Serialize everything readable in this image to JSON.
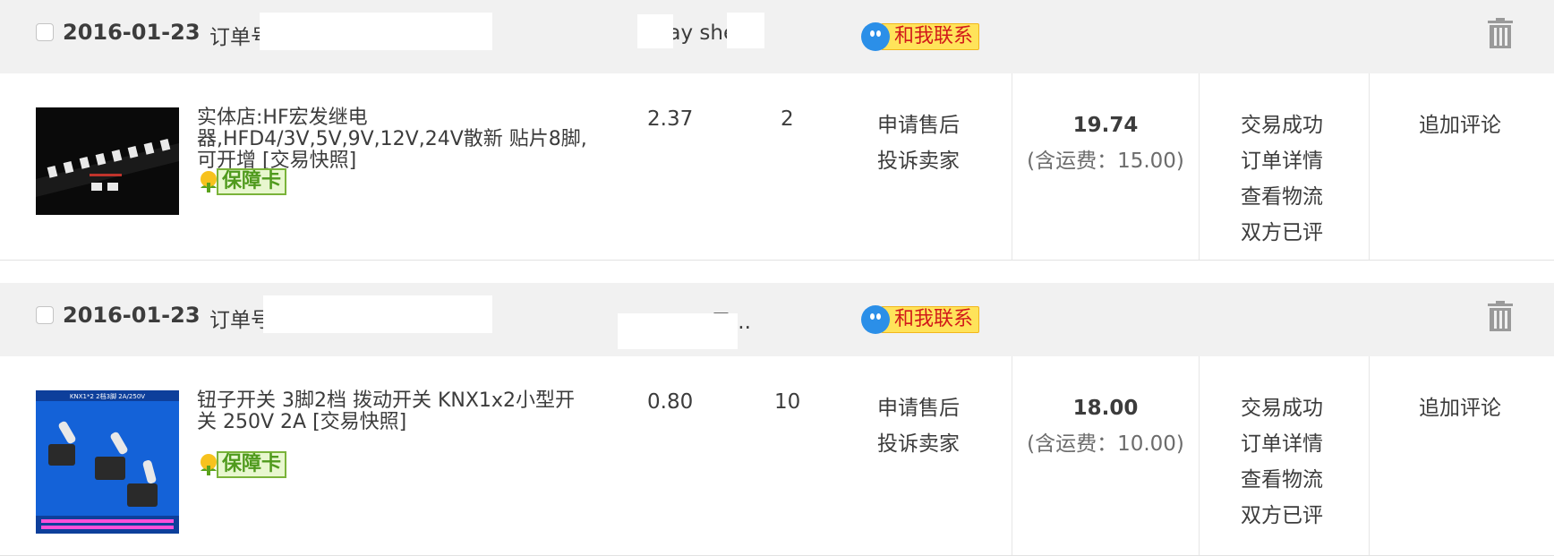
{
  "orders": [
    {
      "date": "2016-01-23",
      "order_no_label": "订单号",
      "shop_name": "lay she",
      "contact_label": "和我联系",
      "item": {
        "title": "实体店:HF宏发继电器,HFD4/3V,5V,9V,12V,24V散新 贴片8脚,可开增 [交易快照]",
        "guarantee_label": "保障卡",
        "unit_price": "2.37",
        "quantity": "2",
        "service_links": [
          "申请售后",
          "投诉卖家"
        ],
        "total": "19.74",
        "shipping": "(含运费：15.00)",
        "status_links": [
          "交易成功",
          "订单详情",
          "查看物流",
          "双方已评"
        ],
        "review_link": "追加评论"
      }
    },
    {
      "date": "2016-01-23",
      "order_no_label": "订单号",
      "shop_name": "子...",
      "contact_label": "和我联系",
      "item": {
        "title": "钮子开关 3脚2档 拨动开关 KNX1x2小型开关 250V 2A [交易快照]",
        "image_caption": "KNX1*2 2档3脚 2A/250V",
        "guarantee_label": "保障卡",
        "unit_price": "0.80",
        "quantity": "10",
        "service_links": [
          "申请售后",
          "投诉卖家"
        ],
        "total": "18.00",
        "shipping": "(含运费：10.00)",
        "status_links": [
          "交易成功",
          "订单详情",
          "查看物流",
          "双方已评"
        ],
        "review_link": "追加评论"
      }
    }
  ],
  "icons": {
    "contact": "chat-bubble-icon",
    "guarantee": "tulip-icon",
    "delete": "trash-icon"
  },
  "colors": {
    "header_bg": "#f1f1f1",
    "contact_bg": "#ffe35a",
    "contact_text": "#d11a1a",
    "guarantee_green": "#7ab33a",
    "icon_blue": "#2b8fe8"
  }
}
